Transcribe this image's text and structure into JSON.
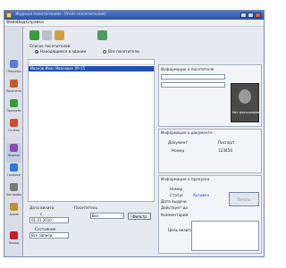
{
  "window": {
    "title": "Журнал посетителей - [Учёт посетителей]"
  },
  "menu": [
    "Файл",
    "Вид",
    "Справка"
  ],
  "sidebar": {
    "items": [
      {
        "label": "Персонал",
        "icon": "person-icon",
        "color": "#5a7bd6"
      },
      {
        "label": "Посетители",
        "icon": "visitors-icon",
        "color": "#c45a2a"
      },
      {
        "label": "Пропуска",
        "icon": "card-icon",
        "color": "#3a9a3a"
      },
      {
        "label": "Отчёты",
        "icon": "report-icon",
        "color": "#d24a2a"
      },
      {
        "label": "Журнал",
        "icon": "journal-icon",
        "color": "#8a4ab0"
      },
      {
        "label": "Графики",
        "icon": "chart-icon",
        "color": "#2a7ad2"
      },
      {
        "label": "Настройки",
        "icon": "settings-icon",
        "color": "#7a7a7a"
      },
      {
        "label": "Архив",
        "icon": "archive-icon",
        "color": "#c0902a"
      },
      {
        "label": "Выход",
        "icon": "exit-icon",
        "color": "#c0202a"
      }
    ]
  },
  "toolbar": {
    "icons": [
      "add-icon",
      "edit-icon",
      "delete-icon",
      "refresh-icon"
    ]
  },
  "list": {
    "group_title": "Список посетителей",
    "radio_current": "Находящиеся в здании",
    "radio_all": "Все посетители",
    "selected_row": "Иванов Иван Иванович          09:15"
  },
  "bottom_left": {
    "date_label": "Дата визита",
    "date_from_label": "с",
    "date_from_value": "01.01.2010",
    "visitor_label": "Посетитель",
    "visitor_select": "Все",
    "apply_button": "Фильтр",
    "status_label": "Состояние",
    "status_select": "Все записи"
  },
  "visitor_panel": {
    "header": "Информация о посетителе",
    "photo_caption": "Нет фотографии",
    "doc_header": "Информация о документе",
    "doc_type_label": "Документ",
    "doc_type_value": "Паспорт",
    "doc_number_label": "Номер",
    "doc_number_value": "123456",
    "pass_header": "Информация о пропуске",
    "pass_number_label": "Номер",
    "pass_status_label": "Статус",
    "pass_status_value": "Активен",
    "pass_issued_label": "Дата выдачи",
    "pass_valid_label": "Действует до",
    "pass_comment_label": "Комментарий",
    "pass_target_label": "Цель визита",
    "print_button": "Печать"
  }
}
